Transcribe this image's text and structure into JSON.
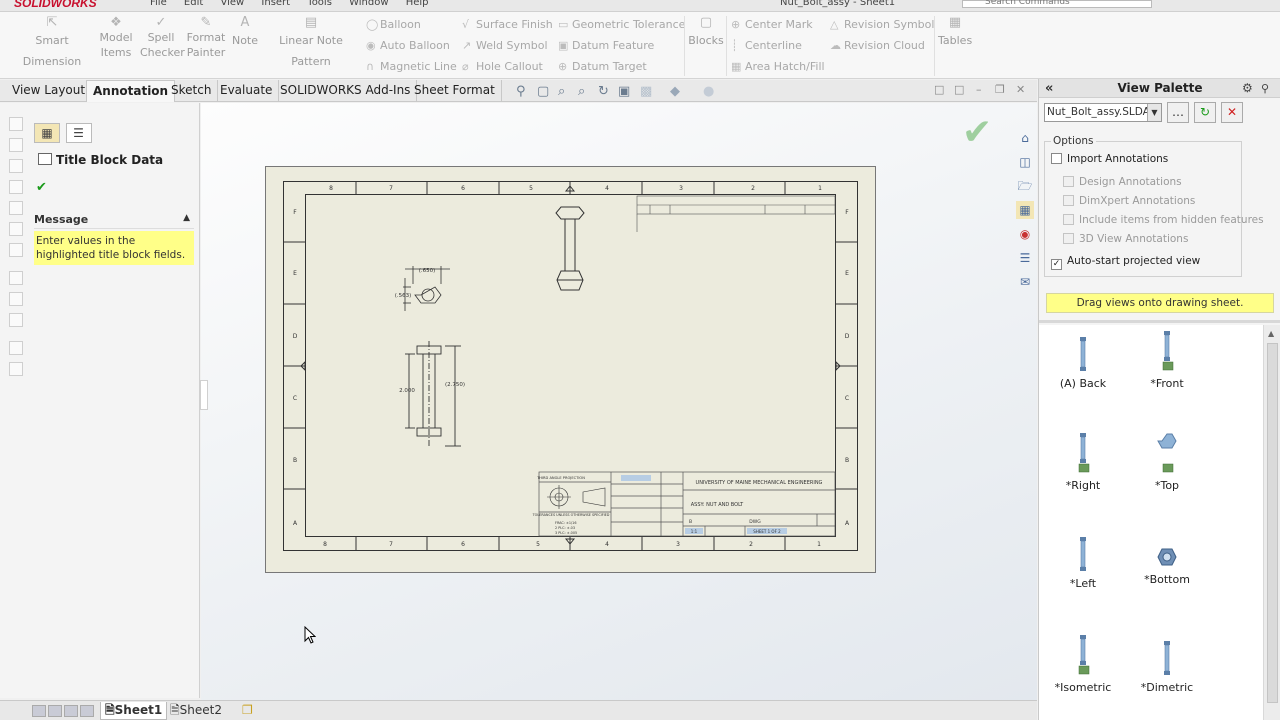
{
  "window": {
    "logo": "SOLIDWORKS",
    "menus": [
      "File",
      "Edit",
      "View",
      "Insert",
      "Tools",
      "Window",
      "Help"
    ],
    "doc_title": "Nut_Bolt_assy - Sheet1",
    "search_placeholder": "Search Commands"
  },
  "ribbon": {
    "smart_dimension": "Smart Dimension",
    "model_items": "Model Items",
    "spell_checker": "Spell Checker",
    "format_painter": "Format Painter",
    "note": "Note",
    "linear_note_pattern": "Linear Note Pattern",
    "balloon": "Balloon",
    "auto_balloon": "Auto Balloon",
    "magnetic_line": "Magnetic Line",
    "surface_finish": "Surface Finish",
    "weld_symbol": "Weld Symbol",
    "hole_callout": "Hole Callout",
    "geometric_tolerance": "Geometric Tolerance",
    "datum_feature": "Datum Feature",
    "datum_target": "Datum Target",
    "blocks": "Blocks",
    "center_mark": "Center Mark",
    "centerline": "Centerline",
    "area_hatch": "Area Hatch/Fill",
    "revision_symbol": "Revision Symbol",
    "revision_cloud": "Revision Cloud",
    "tables": "Tables"
  },
  "tabs": [
    "View Layout",
    "Annotation",
    "Sketch",
    "Evaluate",
    "SOLIDWORKS Add-Ins",
    "Sheet Format"
  ],
  "property_manager": {
    "title": "Title Block Data",
    "message_header": "Message",
    "message_text": "Enter values in the highlighted title block fields."
  },
  "drawing": {
    "zone_numbers": [
      "8",
      "7",
      "6",
      "5",
      "4",
      "3",
      "2",
      "1"
    ],
    "zone_letters": [
      "F",
      "E",
      "D",
      "C",
      "B",
      "A"
    ],
    "dim_top_width": "(.650)",
    "dim_top_height": "(.563)",
    "dim_length": "2.000",
    "dim_total": "(2.750)",
    "tb_company": "UNIVERSITY OF MAINE MECHANICAL ENGINEERING",
    "tb_title": "ASSY: NUT AND BOLT",
    "tb_size": "B",
    "tb_dwg_no": "DWG",
    "tb_sheet": "SHEET 1 OF 2",
    "tb_scale": "1:1",
    "tb_prop": "THIRD ANGLE PROJECTION",
    "tb_tol": "TOLERANCES UNLESS OTHERWISE SPECIFIED",
    "tb_tol_lines": [
      "FRAC: ±1/16",
      "2 PLC: ±.03",
      "3 PLC: ±.005"
    ]
  },
  "view_palette": {
    "title": "View Palette",
    "file": "Nut_Bolt_assy.SLDASM",
    "options_label": "Options",
    "import_annotations": "Import Annotations",
    "design_annotations": "Design Annotations",
    "dimxpert_annotations": "DimXpert Annotations",
    "include_hidden": "Include items from hidden features",
    "view_3d_annotations": "3D View Annotations",
    "auto_start": "Auto-start projected view",
    "hint": "Drag views onto drawing sheet.",
    "views": [
      "(A) Back",
      "*Front",
      "*Right",
      "*Top",
      "*Left",
      "*Bottom",
      "*Isometric",
      "*Dimetric"
    ]
  },
  "sheets": [
    "Sheet1",
    "Sheet2"
  ],
  "colors": {
    "sheet_fill": "#ecebdd",
    "accent_red": "#c8102e",
    "hint_yellow": "#ffff88"
  }
}
